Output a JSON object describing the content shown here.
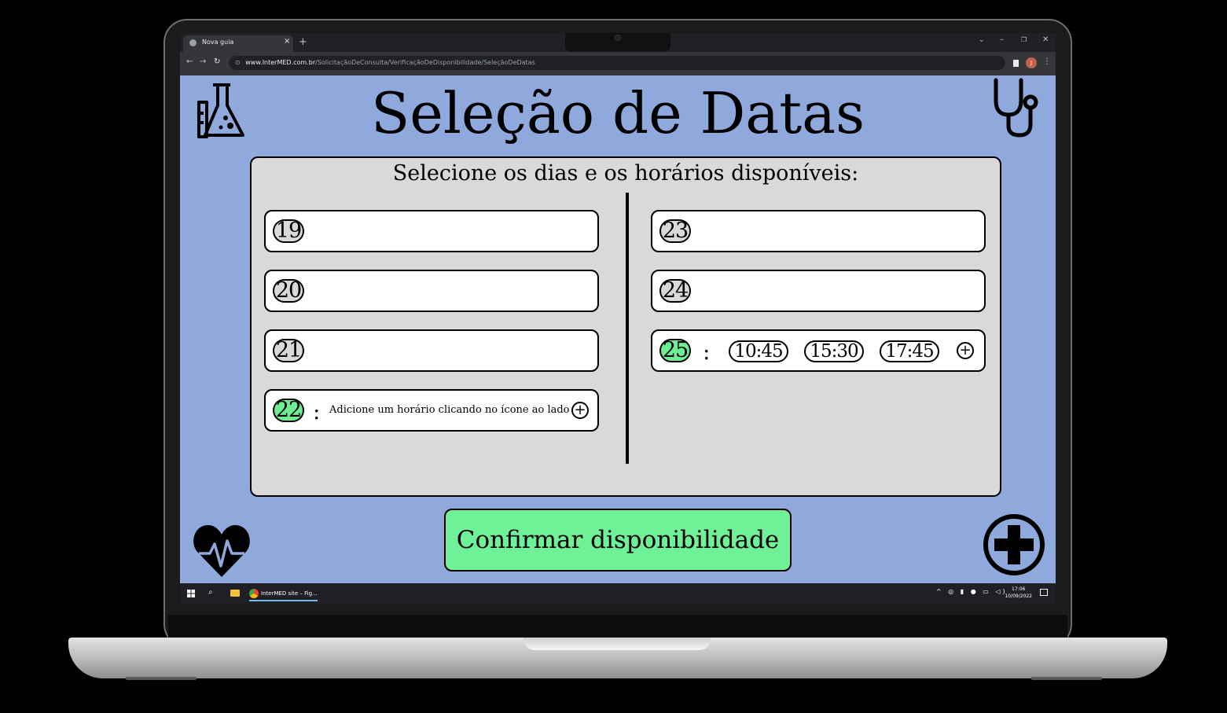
{
  "browser": {
    "tab_title": "Nova guia",
    "url_host": "www.InterMED.com.br",
    "url_path": "/SolicitaçãoDeConsulta/VerificaçãoDeDisponibilidade/SeleçãoDeDatas",
    "profile_initial": "J"
  },
  "page": {
    "title": "Seleção de Datas",
    "subtitle": "Selecione os dias e os horários disponíveis:",
    "confirm_label": "Confirmar disponibilidade"
  },
  "days_left": [
    {
      "day": "19",
      "selected": false
    },
    {
      "day": "20",
      "selected": false
    },
    {
      "day": "21",
      "selected": false
    },
    {
      "day": "22",
      "selected": true,
      "separator": ":",
      "hint": "Adicione um horário clicando no ícone ao lado"
    }
  ],
  "days_right": [
    {
      "day": "23",
      "selected": false
    },
    {
      "day": "24",
      "selected": false
    },
    {
      "day": "25",
      "selected": true,
      "separator": ":",
      "times": [
        "10:45",
        "15:30",
        "17:45"
      ]
    }
  ],
  "taskbar": {
    "app_label": "InterMED site – Fig...",
    "time": "17:06",
    "date": "10/09/2022"
  },
  "icons": [
    "lab-flask-icon",
    "stethoscope-icon",
    "heart-pulse-icon",
    "medical-plus-icon",
    "add-time-icon",
    "windows-start-icon",
    "search-icon",
    "file-explorer-icon",
    "chrome-icon"
  ],
  "colors": {
    "background": "#8fa9dc",
    "panel": "#d9d9d9",
    "selected": "#6cee94",
    "confirm": "#6ef197"
  }
}
